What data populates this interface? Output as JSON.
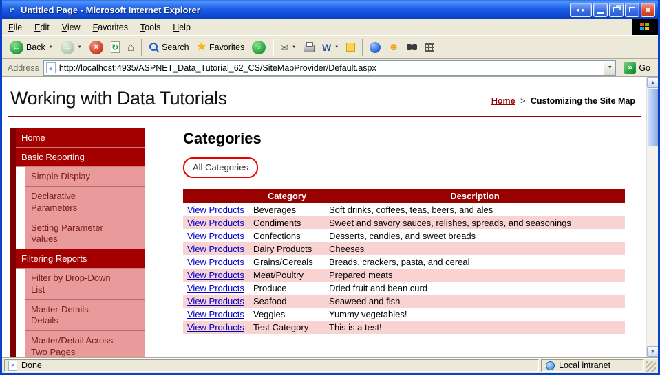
{
  "window": {
    "title": "Untitled Page - Microsoft Internet Explorer",
    "statusbar": {
      "status": "Done",
      "zone": "Local intranet"
    }
  },
  "menu": {
    "items": [
      "File",
      "Edit",
      "View",
      "Favorites",
      "Tools",
      "Help"
    ]
  },
  "toolbar": {
    "back_label": "Back",
    "search_label": "Search",
    "favorites_label": "Favorites"
  },
  "address": {
    "label": "Address",
    "url": "http://localhost:4935/ASPNET_Data_Tutorial_62_CS/SiteMapProvider/Default.aspx",
    "go_label": "Go"
  },
  "page": {
    "header": {
      "title": "Working with Data Tutorials",
      "breadcrumb": {
        "home": "Home",
        "separator": ">",
        "current": "Customizing the Site Map"
      }
    },
    "sidebar": {
      "items": [
        {
          "label": "Home",
          "level": 0
        },
        {
          "label": "Basic Reporting",
          "level": 0
        },
        {
          "label": "Simple Display",
          "level": 1
        },
        {
          "label": "Declarative Parameters",
          "level": 1
        },
        {
          "label": "Setting Parameter Values",
          "level": 1
        },
        {
          "label": "Filtering Reports",
          "level": 0
        },
        {
          "label": "Filter by Drop-Down List",
          "level": 1
        },
        {
          "label": "Master-Details-Details",
          "level": 1
        },
        {
          "label": "Master/Detail Across Two Pages",
          "level": 1
        }
      ]
    },
    "main": {
      "heading": "Categories",
      "all_categories_label": "All Categories",
      "table": {
        "headers": [
          "",
          "Category",
          "Description"
        ],
        "rows": [
          [
            "View Products",
            "Beverages",
            "Soft drinks, coffees, teas, beers, and ales"
          ],
          [
            "View Products",
            "Condiments",
            "Sweet and savory sauces, relishes, spreads, and seasonings"
          ],
          [
            "View Products",
            "Confections",
            "Desserts, candies, and sweet breads"
          ],
          [
            "View Products",
            "Dairy Products",
            "Cheeses"
          ],
          [
            "View Products",
            "Grains/Cereals",
            "Breads, crackers, pasta, and cereal"
          ],
          [
            "View Products",
            "Meat/Poultry",
            "Prepared meats"
          ],
          [
            "View Products",
            "Produce",
            "Dried fruit and bean curd"
          ],
          [
            "View Products",
            "Seafood",
            "Seaweed and fish"
          ],
          [
            "View Products",
            "Veggies",
            "Yummy vegetables!"
          ],
          [
            "View Products",
            "Test Category",
            "This is a test!"
          ]
        ]
      }
    }
  },
  "colors": {
    "maroon": "#990000",
    "dark_maroon": "#7E0000",
    "sidebar_top_level": "#A40000",
    "sidebar_pink": "#E99B9B",
    "row_alt_pink": "#F9D2D2",
    "annotation_red": "#E60000",
    "link_blue": "#0000CC",
    "titlebar_blue": "#1E5EE8"
  }
}
